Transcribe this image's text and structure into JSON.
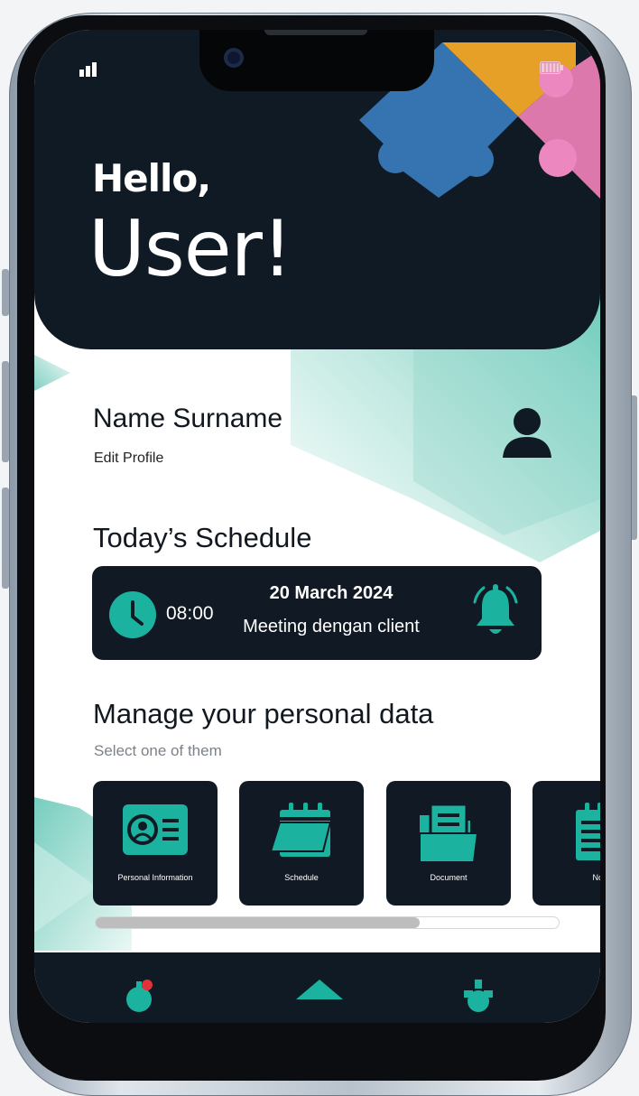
{
  "greeting": {
    "line1": "Hello,",
    "line2": "User!"
  },
  "profile": {
    "name": "Name Surname",
    "edit_label": "Edit Profile"
  },
  "schedule": {
    "section_title": "Today’s Schedule",
    "time": "08:00",
    "date": "20 March 2024",
    "title": "Meeting dengan client"
  },
  "personal_data": {
    "section_title": "Manage your personal data",
    "subtitle": "Select one of them",
    "cards": [
      {
        "label": "Personal Information",
        "icon": "id-card-icon"
      },
      {
        "label": "Schedule",
        "icon": "calendar-icon"
      },
      {
        "label": "Document",
        "icon": "folder-icon"
      },
      {
        "label": "No",
        "icon": "notepad-icon"
      }
    ],
    "scroll_progress": 0.7
  },
  "colors": {
    "dark": "#101a24",
    "teal": "#1bb3a0",
    "blue_piece": "#3574b0",
    "orange_piece": "#e6a027",
    "pink_piece": "#dc78ac"
  },
  "bottom_nav": [
    "notification-icon",
    "home-icon",
    "settings-icon"
  ]
}
